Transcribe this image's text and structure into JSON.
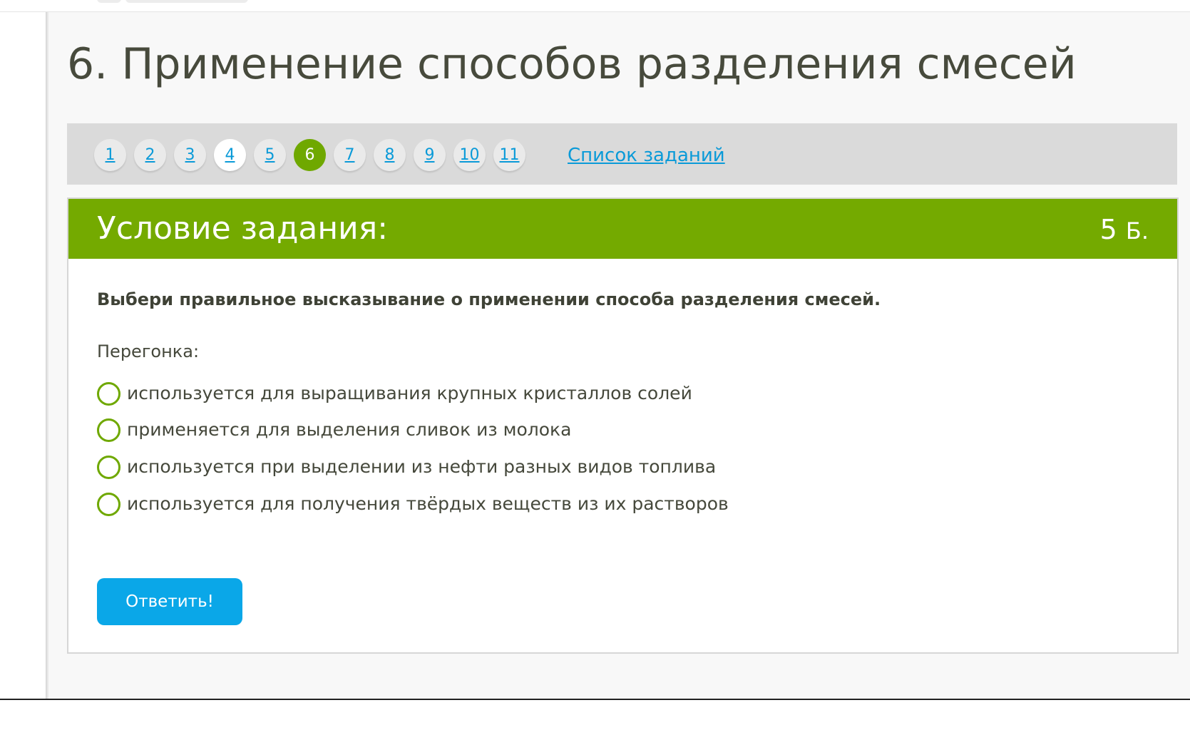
{
  "page": {
    "title": "6. Применение способов разделения смесей"
  },
  "task_nav": {
    "items": [
      {
        "label": "1",
        "state": "default"
      },
      {
        "label": "2",
        "state": "default"
      },
      {
        "label": "3",
        "state": "default"
      },
      {
        "label": "4",
        "state": "visited"
      },
      {
        "label": "5",
        "state": "default"
      },
      {
        "label": "6",
        "state": "current"
      },
      {
        "label": "7",
        "state": "default"
      },
      {
        "label": "8",
        "state": "default"
      },
      {
        "label": "9",
        "state": "default"
      },
      {
        "label": "10",
        "state": "default"
      },
      {
        "label": "11",
        "state": "default"
      }
    ],
    "list_link": "Список заданий"
  },
  "task": {
    "header_title": "Условие задания:",
    "points_value": "5",
    "points_unit": "Б.",
    "question": "Выбери правильное высказывание о применении способа разделения смесей.",
    "subject": "Перегонка:",
    "options": [
      "используется для выращивания крупных кристаллов солей",
      "применяется для выделения сливок из молока",
      "используется при выделении из нефти разных видов топлива",
      "используется для получения твёрдых веществ из их растворов"
    ],
    "submit_label": "Ответить!"
  },
  "colors": {
    "accent_green": "#74aa00",
    "link_blue": "#0a9ad8",
    "button_blue": "#0aa7e8",
    "title_text": "#474a3c"
  }
}
